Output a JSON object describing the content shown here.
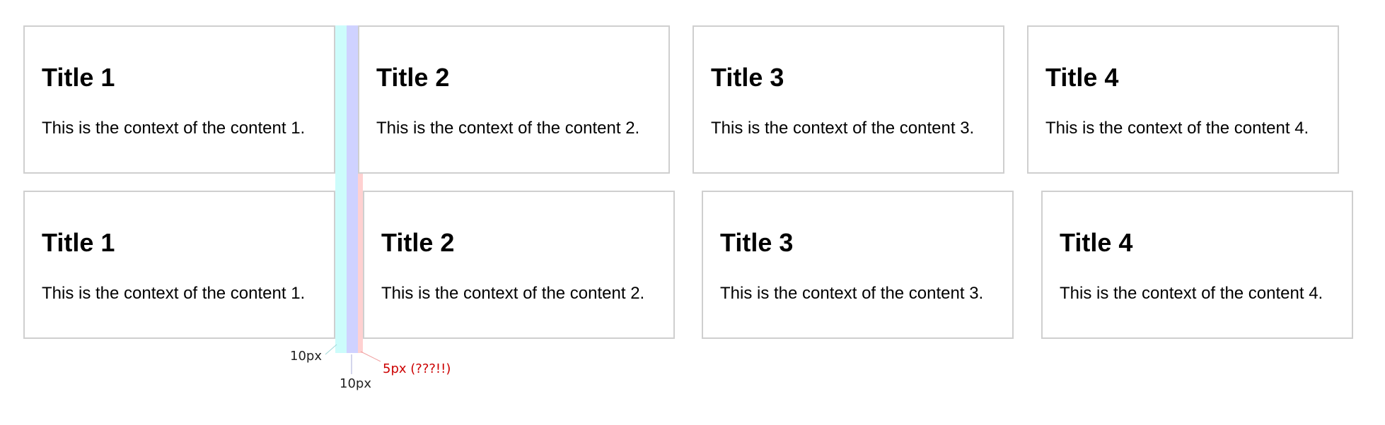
{
  "rows": [
    {
      "cards": [
        {
          "title": "Title 1",
          "text": "This is the context of the content 1."
        },
        {
          "title": "Title 2",
          "text": "This is the context of the content 2."
        },
        {
          "title": "Title 3",
          "text": "This is the context of the content 3."
        },
        {
          "title": "Title 4",
          "text": "This is the context of the content 4."
        }
      ]
    },
    {
      "cards": [
        {
          "title": "Title 1",
          "text": "This is the context of the content 1."
        },
        {
          "title": "Title 2",
          "text": "This is the context of the content 2."
        },
        {
          "title": "Title 3",
          "text": "This is the context of the content 3."
        },
        {
          "title": "Title 4",
          "text": "This is the context of the content 4."
        }
      ]
    }
  ],
  "annotations": {
    "left_gap": "10px",
    "middle_gap": "10px",
    "extra_gap": "5px (???!!)"
  },
  "colors": {
    "card_border": "#cfcfcf",
    "gap_cyan": "#ccfcfb",
    "gap_blue": "#cfd2ff",
    "gap_pink": "#ffd1d1",
    "extra_label": "#cc0000",
    "label_text": "#222222"
  }
}
